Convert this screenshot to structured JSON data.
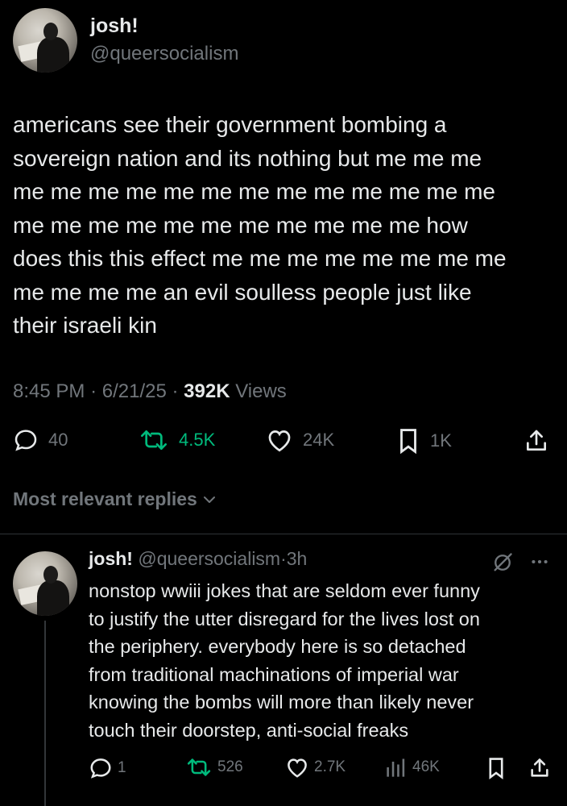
{
  "tweet": {
    "display_name": "josh!",
    "handle": "@queersocialism",
    "text": "americans see their government bombing a\nsovereign nation and its nothing but me me me\nme me me me me me me me me me me me me\nme me me me me me me me me me me how\ndoes this this effect me me me me me me me me\nme me me me an evil soulless people just like\ntheir israeli kin",
    "time": "8:45 PM",
    "date": "6/21/25",
    "separator": "·",
    "views_count": "392K",
    "views_label": "Views",
    "actions": {
      "replies": "40",
      "retweets": "4.5K",
      "likes": "24K",
      "bookmarks": "1K"
    }
  },
  "replies_sort": {
    "label": "Most relevant replies"
  },
  "reply": {
    "display_name": "josh!",
    "handle": "@queersocialism",
    "separator": "·",
    "time": "3h",
    "text": "nonstop wwiii jokes that are seldom ever funny\nto justify the utter disregard for the lives lost on\nthe periphery. everybody here is so detached\nfrom traditional machinations of imperial war\nknowing the bombs will more than likely never\ntouch their doorstep, anti-social freaks",
    "actions": {
      "replies": "1",
      "retweets": "526",
      "likes": "2.7K",
      "views": "46K"
    }
  },
  "colors": {
    "background": "#000000",
    "text": "#e7e9ea",
    "muted": "#71767b",
    "retweet_active": "#00ba7c",
    "divider": "#2f3336"
  },
  "icons": [
    "reply-icon",
    "retweet-icon",
    "like-icon",
    "bookmark-icon",
    "share-icon",
    "chevron-down-icon",
    "grok-icon",
    "more-icon",
    "views-icon"
  ]
}
